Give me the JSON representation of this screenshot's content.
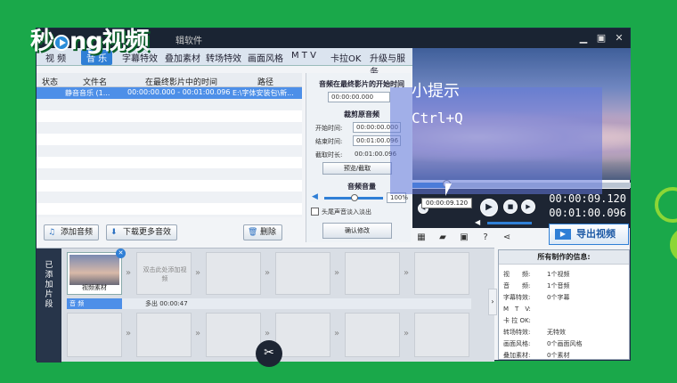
{
  "app": {
    "logo_text": "秒懂视频",
    "title": "辑软件"
  },
  "tabs": [
    "视 频",
    "音 乐",
    "字幕特效",
    "叠加素材",
    "转场特效",
    "画面风格",
    "M T V",
    "卡拉OK",
    "升级与服务"
  ],
  "list": {
    "headers": [
      "状态",
      "文件名",
      "在最终影片中的时间",
      "路径"
    ],
    "selected_row": {
      "filename": "静音音乐 (1...",
      "time_range": "00:00:00.000 - 00:01:00.096",
      "path": "E:\\字体安装包\\新..."
    },
    "buttons": {
      "add_audio": "添加音频",
      "download_more": "下载更多音效",
      "delete": "删除"
    }
  },
  "audio_panel": {
    "start_title": "音频在最终影片的开始时间",
    "start_value": "00:00:00.000",
    "crop_title": "裁剪原音频",
    "start_label": "开始时间:",
    "start_time": "00:00:00.000",
    "end_label": "结束时间:",
    "end_time": "00:01:00.096",
    "duration_label": "截取时长:",
    "duration": "00:01:00.096",
    "preview_btn": "预览/截取",
    "volume_title": "音频音量",
    "volume_value": "100%",
    "fade_label": "头尾声音淡入淡出",
    "confirm_btn": "确认修改"
  },
  "hint": {
    "title": "小提示",
    "shortcut": "Ctrl+Q"
  },
  "player": {
    "tooltip_time": "00:00:09.120",
    "current_time": "00:00:09.120",
    "total_time": "00:01:00.096",
    "progress": 0.15
  },
  "export_label": "导出视频",
  "timeline": {
    "side_label": "已添加片段",
    "clip_label": "视频素材",
    "add_hint": "双击此处添加视频",
    "audio_label": "音 频",
    "audio_note": "多出 00:00:47"
  },
  "info": {
    "title": "所有制作的信息:",
    "rows": [
      {
        "k": "视　　频:",
        "v": "1个视频"
      },
      {
        "k": "音　　频:",
        "v": "1个音频"
      },
      {
        "k": "字幕特效:",
        "v": "0个字幕"
      },
      {
        "k": "M　T　V:",
        "v": ""
      },
      {
        "k": "卡 拉 OK:",
        "v": ""
      },
      {
        "k": "转场特效:",
        "v": "无特效"
      },
      {
        "k": "画面风格:",
        "v": "0个画面风格"
      },
      {
        "k": "叠加素材:",
        "v": "0个素材"
      }
    ]
  }
}
